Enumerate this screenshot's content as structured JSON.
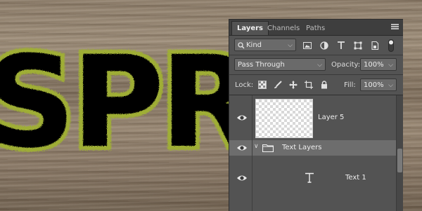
{
  "canvas": {
    "letters": [
      "S",
      "P",
      "R"
    ],
    "wood_color": "#8c7c69",
    "text_fill": "#050505",
    "grass_color": "#8a9a2a"
  },
  "panel": {
    "tabs": [
      {
        "label": "Layers",
        "active": true
      },
      {
        "label": "Channels",
        "active": false
      },
      {
        "label": "Paths",
        "active": false
      }
    ],
    "filter": {
      "kind_label": "Kind",
      "icons": [
        "image-filter-icon",
        "adjustment-filter-icon",
        "type-filter-icon",
        "shape-filter-icon",
        "smart-object-filter-icon",
        "filter-toggle-icon"
      ]
    },
    "blend": {
      "mode": "Pass Through",
      "opacity_label": "Opacity:",
      "opacity_value": "100%"
    },
    "lock": {
      "label": "Lock:",
      "icons": [
        "lock-transparent-icon",
        "lock-image-icon",
        "lock-position-icon",
        "lock-artboard-icon",
        "lock-all-icon"
      ],
      "fill_label": "Fill:",
      "fill_value": "100%"
    },
    "layers": [
      {
        "name": "Layer 5",
        "type": "pixel",
        "selected": false
      },
      {
        "name": "Text Layers",
        "type": "group",
        "selected": true
      },
      {
        "name": "Text 1",
        "type": "text",
        "selected": false
      }
    ],
    "colors": {
      "panel_bg": "#535353",
      "tab_bg": "#3e3e3e",
      "selected_row": "#6d6d6d"
    }
  }
}
